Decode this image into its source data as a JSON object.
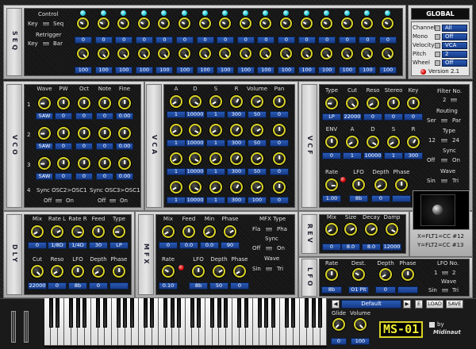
{
  "seq": {
    "title": "SEQ",
    "control_label": "Control",
    "key_label": "Key",
    "seq_label": "Seq",
    "retrigger_label": "Retrigger",
    "key2_label": "Key",
    "bar_label": "Bar",
    "step_values_top": [
      "0",
      "0",
      "0",
      "0",
      "0",
      "0",
      "0",
      "0",
      "0",
      "0",
      "0",
      "0",
      "0",
      "0",
      "0",
      "0"
    ],
    "step_values_bottom": [
      "100",
      "100",
      "100",
      "100",
      "100",
      "100",
      "100",
      "100",
      "100",
      "100",
      "100",
      "100",
      "100",
      "100",
      "100",
      "100"
    ]
  },
  "global": {
    "title": "GLOBAL",
    "rows": [
      {
        "label": "Channel",
        "value": "All"
      },
      {
        "label": "Mono",
        "value": "Off"
      },
      {
        "label": "Velocity",
        "value": "VCA"
      },
      {
        "label": "Pitch",
        "value": "2"
      },
      {
        "label": "Wheel",
        "value": "Off"
      }
    ],
    "version": "Version 2.1"
  },
  "vco": {
    "title": "VCO",
    "headers": [
      "Wave",
      "PW",
      "Oct",
      "Note",
      "Fine"
    ],
    "rows": [
      {
        "num": "1",
        "values": [
          "SAW",
          "0",
          "0",
          "0",
          "0.00"
        ]
      },
      {
        "num": "2",
        "values": [
          "SAW",
          "0",
          "0",
          "0",
          "0.00"
        ]
      },
      {
        "num": "3",
        "values": [
          "SAW",
          "0",
          "0",
          "0",
          "0.00"
        ]
      }
    ],
    "row4_num": "4",
    "sync1_label": "Sync OSC2>OSC1",
    "sync2_label": "Sync OSC3>OSC1",
    "off1": "Off",
    "on1": "On",
    "off2": "Off",
    "on2": "On"
  },
  "vca": {
    "title": "VCA",
    "headers": [
      "A",
      "D",
      "S",
      "R",
      "Volume",
      "Pan"
    ],
    "rows": [
      {
        "values": [
          "1",
          "10000",
          "1",
          "300",
          "50",
          "0"
        ]
      },
      {
        "values": [
          "1",
          "10000",
          "1",
          "300",
          "50",
          "0"
        ]
      },
      {
        "values": [
          "1",
          "10000",
          "1",
          "300",
          "50",
          "0"
        ]
      },
      {
        "values": [
          "1",
          "10000",
          "1",
          "300",
          "100",
          "0"
        ]
      }
    ]
  },
  "vcf": {
    "title": "VCF",
    "headers": [
      "Type",
      "Cut",
      "Reso",
      "Stereo",
      "Key"
    ],
    "values": [
      "LP",
      "22000",
      "0",
      "0",
      "0"
    ],
    "filter_no_label": "Filter No.",
    "filter_no_value": "2",
    "routing_label": "Routing",
    "ser_label": "Ser",
    "par_label": "Par",
    "type_label": "Type",
    "type_12": "12",
    "type_24": "24",
    "env_headers": [
      "ENV",
      "A",
      "D",
      "S",
      "R"
    ],
    "env_values": [
      "0",
      "1",
      "10000",
      "1",
      "300"
    ],
    "sync_label": "Sync",
    "sync_off": "Off",
    "sync_on": "On",
    "lfo_headers": [
      "Rate",
      "LFO",
      "Depth",
      "Phase"
    ],
    "lfo_values": [
      "1.00",
      "8b",
      "0",
      ""
    ],
    "wave_label": "Wave",
    "sin_label": "Sin",
    "tri_label": "Tri"
  },
  "dly": {
    "title": "DLY",
    "headers": [
      "Mix",
      "Rate L",
      "Rate R",
      "Feed",
      "Type"
    ],
    "values": [
      "0",
      "1/8D",
      "1/4D",
      "30",
      "LP"
    ],
    "headers2": [
      "Cut",
      "Reso",
      "LFO",
      "Depth",
      "Phase"
    ],
    "values2": [
      "22000",
      "0",
      "8b",
      "0",
      ""
    ]
  },
  "mfx": {
    "title": "MFX",
    "headers": [
      "Mix",
      "Feed",
      "Min",
      "Phase"
    ],
    "values": [
      "0",
      "0.0",
      "0.0",
      "90"
    ],
    "type_label": "MFX Type",
    "fla_label": "Fla",
    "pha_label": "Pha",
    "sync_label": "Sync",
    "sync_off": "Off",
    "sync_on": "On",
    "headers2": [
      "Rate",
      "LFO",
      "Depth",
      "Phase"
    ],
    "values2": [
      "0.10",
      "8b",
      "50",
      "0"
    ],
    "wave_label": "Wave",
    "sin_label": "Sin",
    "tri_label": "Tri"
  },
  "rev": {
    "title": "REV",
    "headers": [
      "Mix",
      "Size",
      "Decay",
      "Damp"
    ],
    "values": [
      "0",
      "8.0",
      "8.0",
      "12000"
    ]
  },
  "xy": {
    "x_label": "X=FLT1=CC #12",
    "y_label": "Y=FLT2=CC #13"
  },
  "lfo": {
    "title": "LFO",
    "headers": [
      "Rate",
      "Dest.",
      "Depth",
      "Phase"
    ],
    "values": [
      "8b",
      "O1 Pit",
      "0",
      ""
    ],
    "lfo_no_label": "LFO No.",
    "lfo_no_1": "1",
    "lfo_no_2": "2",
    "wave_label": "Wave",
    "sin_label": "Sin",
    "tri_label": "Tri"
  },
  "bottom": {
    "preset_name": "Default",
    "prev_label": "◀",
    "next_label": "▶",
    "e_label": "E",
    "load_label": "LOAD",
    "save_label": "SAVE",
    "glide_label": "Glide",
    "volume_label": "Volume",
    "glide_value": "0",
    "volume_value": "100",
    "logo_text": "MS-01",
    "by_label": "by",
    "brand": "Midinaut"
  },
  "colors": {
    "knob_ring": "#d9d326",
    "value_bg": "#2a5ab6",
    "led_cyan": "#1fc6d8",
    "led_red": "#d10000"
  }
}
